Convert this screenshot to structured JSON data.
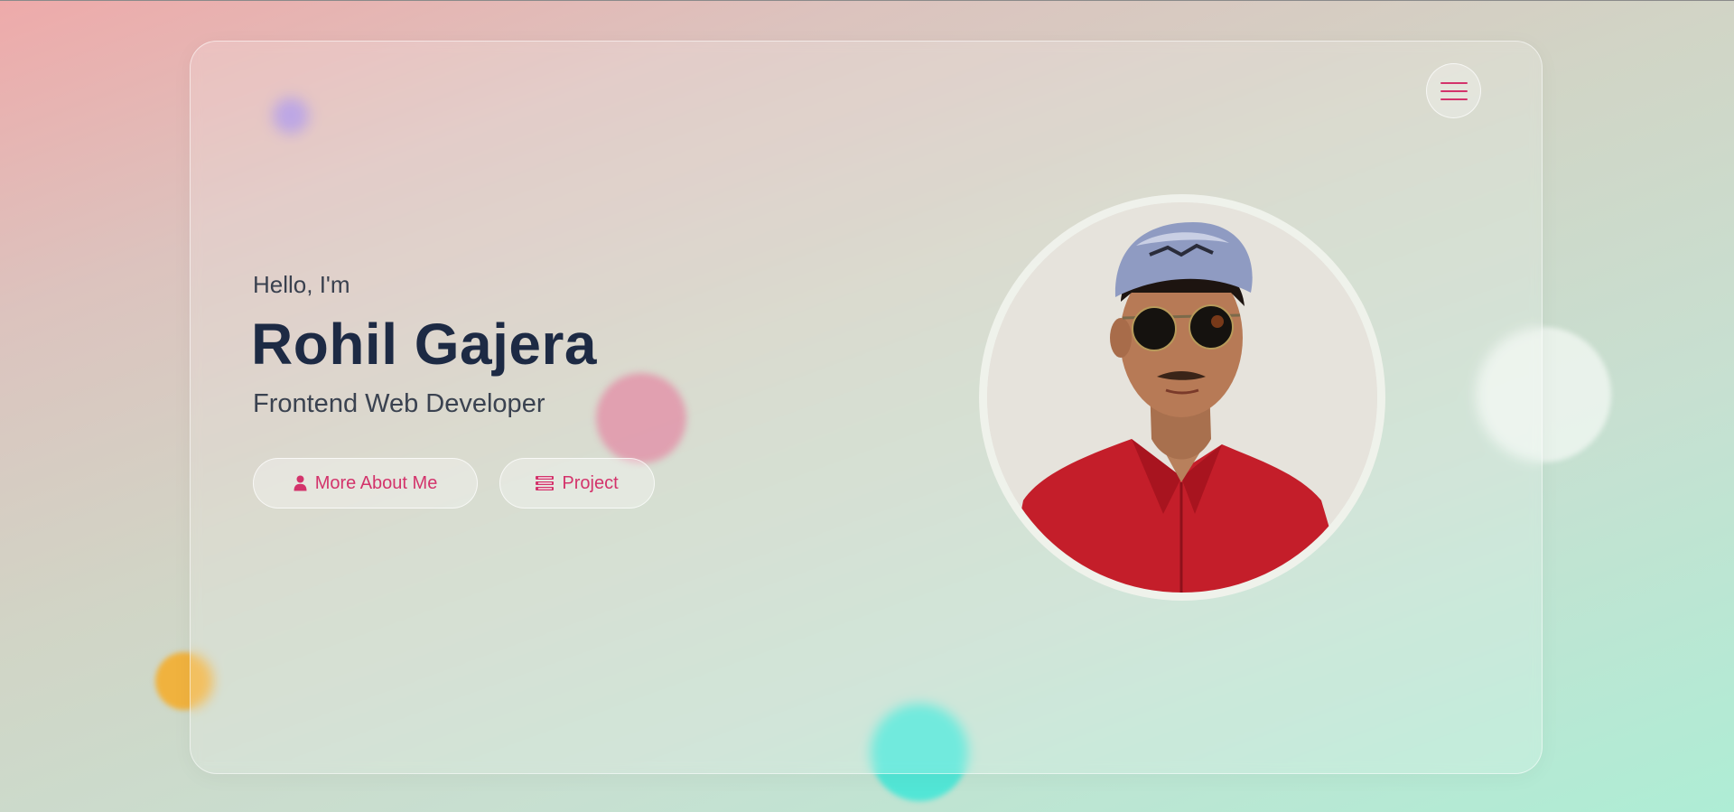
{
  "hero": {
    "greeting": "Hello, I'm",
    "name": "Rohil Gajera",
    "role": "Frontend Web Developer"
  },
  "buttons": {
    "about": {
      "label": "More About Me",
      "icon": "user-icon"
    },
    "project": {
      "label": "Project",
      "icon": "list-icon"
    }
  },
  "menu": {
    "icon": "hamburger-menu-icon"
  },
  "colors": {
    "accent": "#d3336b",
    "heading": "#1d2a44",
    "text": "#3a4250"
  }
}
